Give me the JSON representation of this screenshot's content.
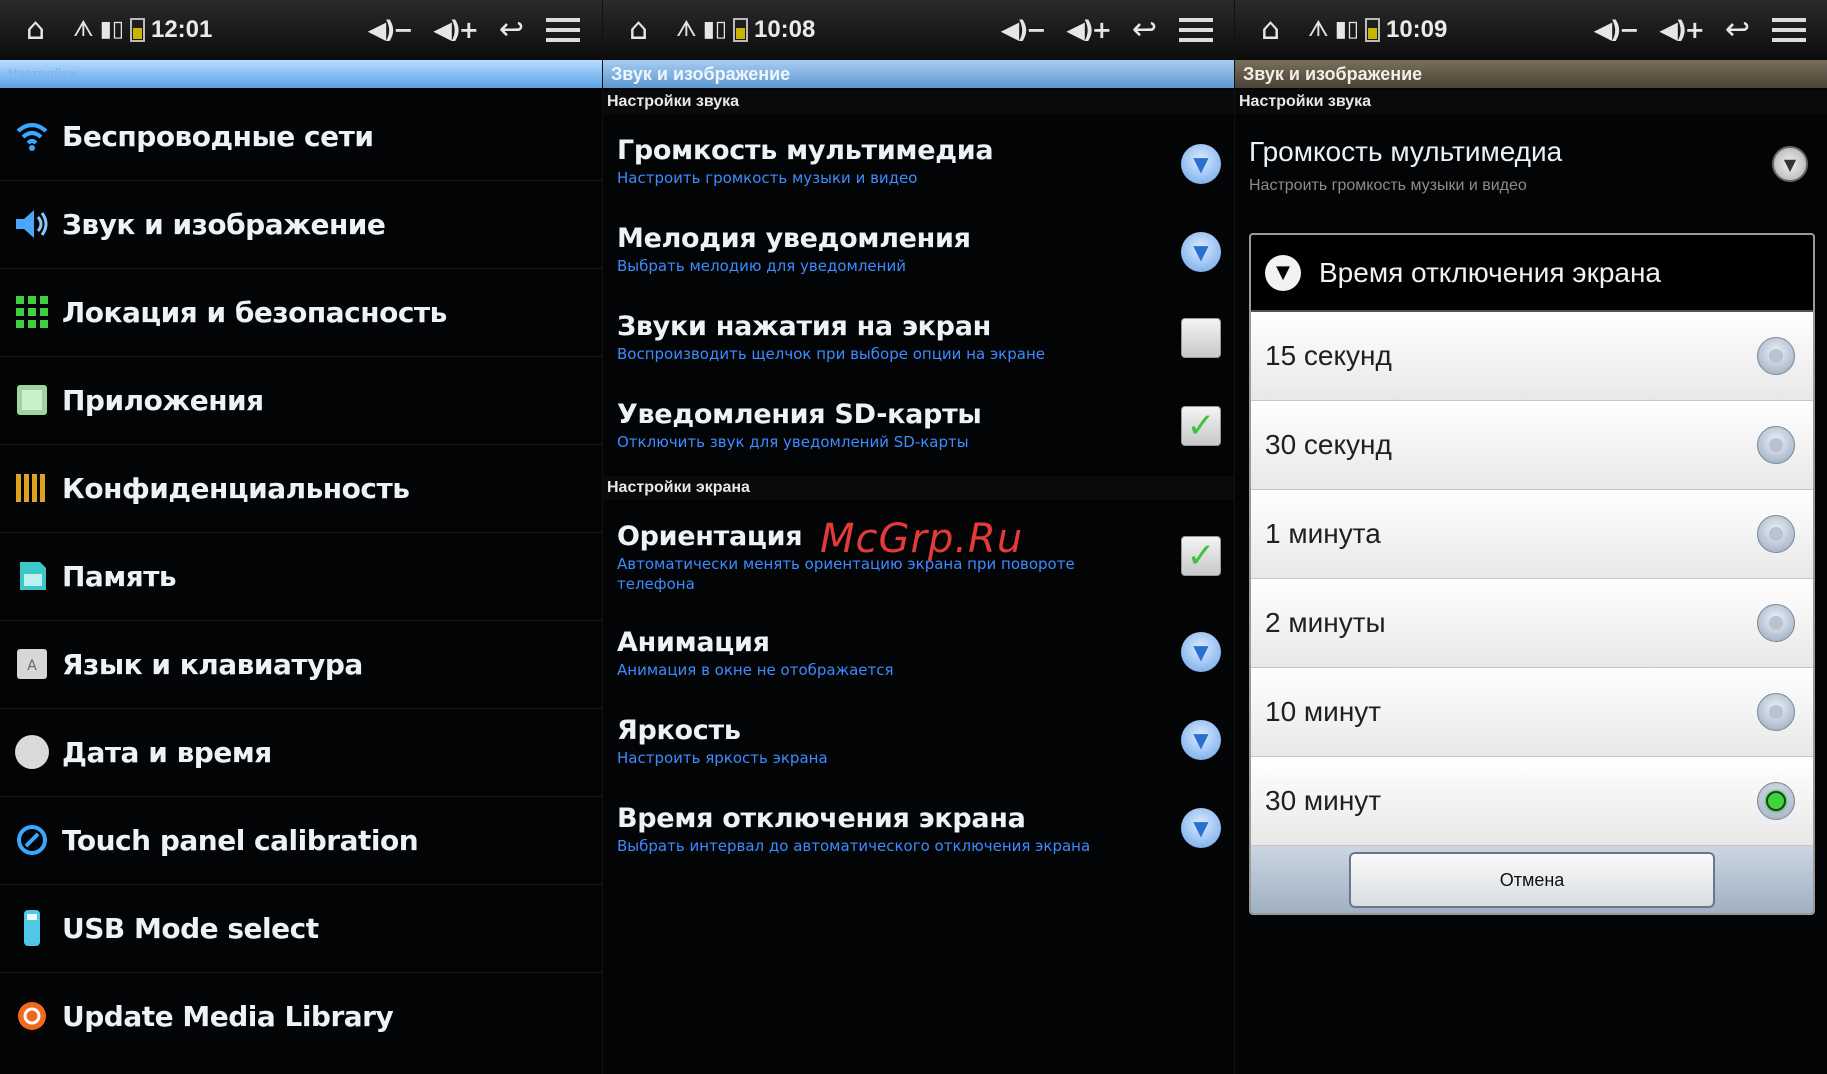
{
  "watermark": "McGrp.Ru",
  "screens": [
    {
      "status": {
        "time": "12:01",
        "vol_down": "◀)−",
        "vol_up": "◀)+"
      },
      "title": "Настройки",
      "items": [
        {
          "label": "Беспроводные сети",
          "icon": "wifi-icon"
        },
        {
          "label": "Звук и изображение",
          "icon": "speaker-icon"
        },
        {
          "label": "Локация и безопасность",
          "icon": "grid-icon"
        },
        {
          "label": "Приложения",
          "icon": "apps-icon"
        },
        {
          "label": "Конфиденциальность",
          "icon": "privacy-icon"
        },
        {
          "label": "Память",
          "icon": "sdcard-icon"
        },
        {
          "label": "Язык и клавиатура",
          "icon": "keyboard-icon"
        },
        {
          "label": "Дата и время",
          "icon": "clock-icon"
        },
        {
          "label": "Touch panel calibration",
          "icon": "calibration-icon"
        },
        {
          "label": "USB Mode select",
          "icon": "usb-icon"
        },
        {
          "label": "Update Media Library",
          "icon": "media-icon"
        }
      ]
    },
    {
      "status": {
        "time": "10:08",
        "vol_down": "◀)−",
        "vol_up": "◀)+"
      },
      "title": "Звук и изображение",
      "section_sound": "Настройки звука",
      "section_screen": "Настройки экрана",
      "prefs": [
        {
          "title": "Громкость мультимедиа",
          "summary": "Настроить громкость музыки и видео",
          "control": "button"
        },
        {
          "title": "Мелодия уведомления",
          "summary": "Выбрать мелодию для уведомлений",
          "control": "button"
        },
        {
          "title": "Звуки нажатия на экран",
          "summary": "Воспроизводить щелчок при выборе опции на экране",
          "control": "checkbox",
          "checked": false
        },
        {
          "title": "Уведомления SD-карты",
          "summary": "Отключить звук для уведомлений SD-карты",
          "control": "checkbox",
          "checked": true
        },
        {
          "title": "Ориентация",
          "summary": "Автоматически менять ориентацию экрана при повороте телефона",
          "control": "checkbox",
          "checked": true
        },
        {
          "title": "Анимация",
          "summary": "Анимация в окне не отображается",
          "control": "button"
        },
        {
          "title": "Яркость",
          "summary": "Настроить яркость экрана",
          "control": "button"
        },
        {
          "title": "Время отключения экрана",
          "summary": "Выбрать интервал до автоматического отключения экрана",
          "control": "button"
        }
      ]
    },
    {
      "status": {
        "time": "10:09",
        "vol_down": "◀)−",
        "vol_up": "◀)+"
      },
      "title": "Звук и изображение",
      "section_sound": "Настройки звука",
      "pref_title": "Громкость мультимедиа",
      "pref_summary": "Настроить громкость музыки и видео",
      "dialog": {
        "title": "Время отключения экрана",
        "options": [
          "15 секунд",
          "30 секунд",
          "1 минута",
          "2 минуты",
          "10 минут",
          "30 минут"
        ],
        "selected": "30 минут",
        "cancel": "Отмена"
      }
    }
  ]
}
